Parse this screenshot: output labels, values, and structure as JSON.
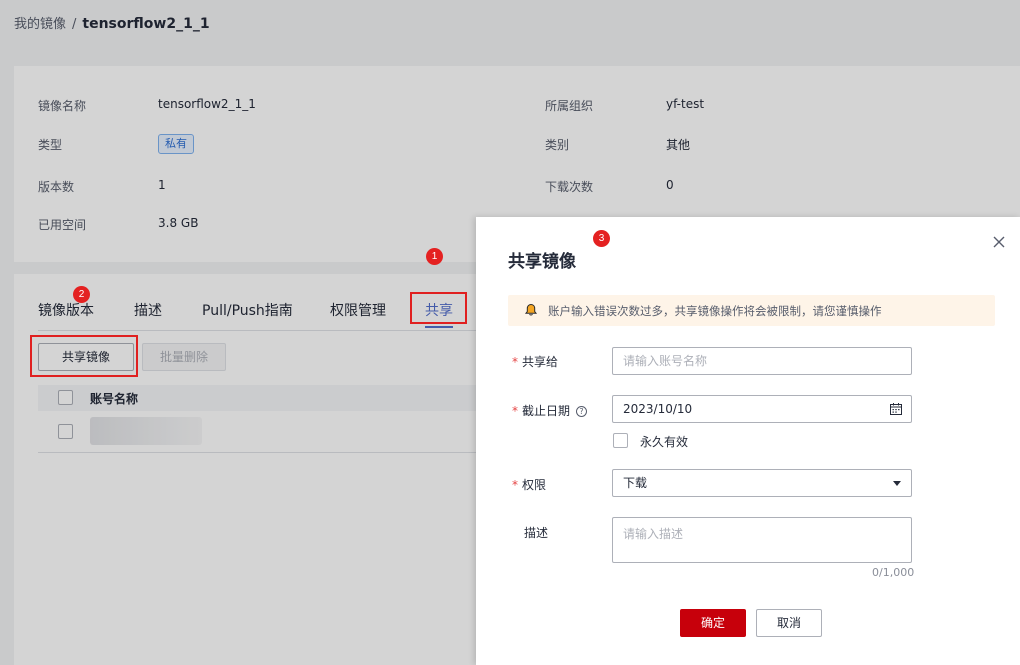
{
  "breadcrumb": {
    "parent": "我的镜像",
    "separator": "/",
    "current": "tensorflow2_1_1"
  },
  "info": {
    "name_label": "镜像名称",
    "name_value": "tensorflow2_1_1",
    "type_label": "类型",
    "type_value": "私有",
    "versions_label": "版本数",
    "versions_value": "1",
    "space_label": "已用空间",
    "space_value": "3.8 GB",
    "org_label": "所属组织",
    "org_value": "yf-test",
    "category_label": "类别",
    "category_value": "其他",
    "downloads_label": "下载次数",
    "downloads_value": "0"
  },
  "tabs": [
    {
      "label": "镜像版本"
    },
    {
      "label": "描述"
    },
    {
      "label": "Pull/Push指南"
    },
    {
      "label": "权限管理"
    },
    {
      "label": "共享",
      "active": true
    }
  ],
  "toolbar": {
    "share_label": "共享镜像",
    "batch_delete_label": "批量删除"
  },
  "table": {
    "header_account": "账号名称"
  },
  "markers": [
    "1",
    "2",
    "3"
  ],
  "drawer": {
    "title": "共享镜像",
    "alert": "账户输入错误次数过多，共享镜像操作将会被限制，请您谨慎操作",
    "share_to_label": "共享给",
    "share_to_placeholder": "请输入账号名称",
    "deadline_label": "截止日期",
    "deadline_value": "2023/10/10",
    "permanent_label": "永久有效",
    "permission_label": "权限",
    "permission_value": "下载",
    "desc_label": "描述",
    "desc_placeholder": "请输入描述",
    "counter": "0/1,000",
    "confirm_label": "确定",
    "cancel_label": "取消"
  },
  "colors": {
    "accent": "#526ecc",
    "confirm": "#c7000b",
    "annotation": "#e02020",
    "required": "#e54545"
  }
}
